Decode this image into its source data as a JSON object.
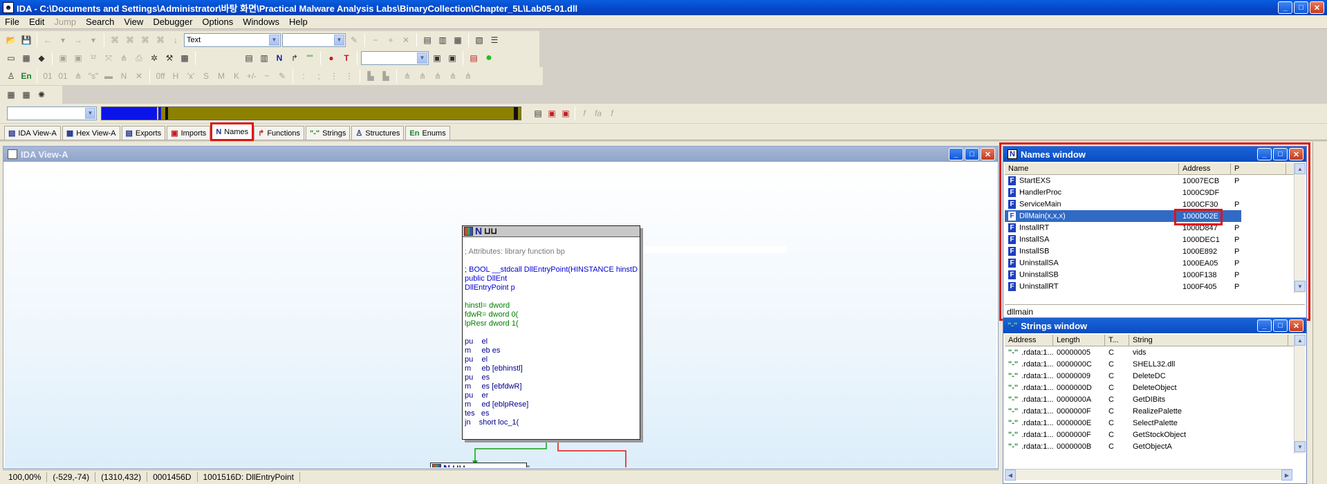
{
  "window": {
    "title": "IDA - C:\\Documents and Settings\\Administrator\\바탕 화면\\Practical Malware Analysis Labs\\BinaryCollection\\Chapter_5L\\Lab05-01.dll"
  },
  "menu": [
    "File",
    "Edit",
    "Jump",
    "Search",
    "View",
    "Debugger",
    "Options",
    "Windows",
    "Help"
  ],
  "toolbar": {
    "display_combo": "Text"
  },
  "tabs": [
    {
      "label": "IDA View-A",
      "icon": "document-icon"
    },
    {
      "label": "Hex View-A",
      "icon": "hex-icon"
    },
    {
      "label": "Exports",
      "icon": "exports-icon"
    },
    {
      "label": "Imports",
      "icon": "imports-icon"
    },
    {
      "label": "Names",
      "icon": "names-icon",
      "active": true
    },
    {
      "label": "Functions",
      "icon": "functions-icon"
    },
    {
      "label": "Strings",
      "icon": "strings-icon"
    },
    {
      "label": "Structures",
      "icon": "structures-icon"
    },
    {
      "label": "Enums",
      "icon": "enums-icon"
    }
  ],
  "ida_view": {
    "title": "IDA View-A",
    "node_lines": [
      "",
      "; Attributes: library function bp",
      "",
      "; BOOL __stdcall DllEntryPoint(HINSTANCE hinstDLL",
      "public DllEnt",
      "DllEntryPoint p",
      "",
      "hinstl= dword ",
      "fdwR= dword 0(",
      "lpResr dword 1(",
      "",
      "pu    el",
      "m     eb es",
      "pu    el",
      "m     eb [ebhinstl]",
      "pu    es",
      "m     es [ebfdwR]",
      "pu    er",
      "m     ed [eblpRese]",
      "tes   es",
      "jn    short loc_1("
    ],
    "status": [
      "100,00%",
      "(-529,-74)",
      "(1310,432)",
      "0001456D",
      "1001516D: DllEntryPoint"
    ]
  },
  "names_window": {
    "title": "Names window",
    "columns": [
      "Name",
      "Address",
      "P"
    ],
    "rows": [
      {
        "name": "StartEXS",
        "address": "10007ECB",
        "p": "P"
      },
      {
        "name": "HandlerProc",
        "address": "1000C9DF",
        "p": ""
      },
      {
        "name": "ServiceMain",
        "address": "1000CF30",
        "p": "P"
      },
      {
        "name": "DllMain(x,x,x)",
        "address": "1000D02E",
        "p": "",
        "selected": true
      },
      {
        "name": "InstallRT",
        "address": "1000D847",
        "p": "P"
      },
      {
        "name": "InstallSA",
        "address": "1000DEC1",
        "p": "P"
      },
      {
        "name": "InstallSB",
        "address": "1000E892",
        "p": "P"
      },
      {
        "name": "UninstallSA",
        "address": "1000EA05",
        "p": "P"
      },
      {
        "name": "UninstallSB",
        "address": "1000F138",
        "p": "P"
      },
      {
        "name": "UninstallRT",
        "address": "1000F405",
        "p": "P"
      }
    ],
    "filter": "dllmain"
  },
  "strings_window": {
    "title": "Strings window",
    "columns": [
      "Address",
      "Length",
      "T...",
      "String"
    ],
    "rows": [
      {
        "address": ".rdata:1...",
        "length": "00000005",
        "type": "C",
        "string": "vids"
      },
      {
        "address": ".rdata:1...",
        "length": "0000000C",
        "type": "C",
        "string": "SHELL32.dll"
      },
      {
        "address": ".rdata:1...",
        "length": "00000009",
        "type": "C",
        "string": "DeleteDC"
      },
      {
        "address": ".rdata:1...",
        "length": "0000000D",
        "type": "C",
        "string": "DeleteObject"
      },
      {
        "address": ".rdata:1...",
        "length": "0000000A",
        "type": "C",
        "string": "GetDIBits"
      },
      {
        "address": ".rdata:1...",
        "length": "0000000F",
        "type": "C",
        "string": "RealizePalette"
      },
      {
        "address": ".rdata:1...",
        "length": "0000000E",
        "type": "C",
        "string": "SelectPalette"
      },
      {
        "address": ".rdata:1...",
        "length": "0000000F",
        "type": "C",
        "string": "GetStockObject"
      },
      {
        "address": ".rdata:1...",
        "length": "0000000B",
        "type": "C",
        "string": "GetObjectA"
      }
    ]
  },
  "colors": {
    "highlight": "#e01414",
    "selection": "#316ac5",
    "title_blue": "#0a5ee0"
  }
}
